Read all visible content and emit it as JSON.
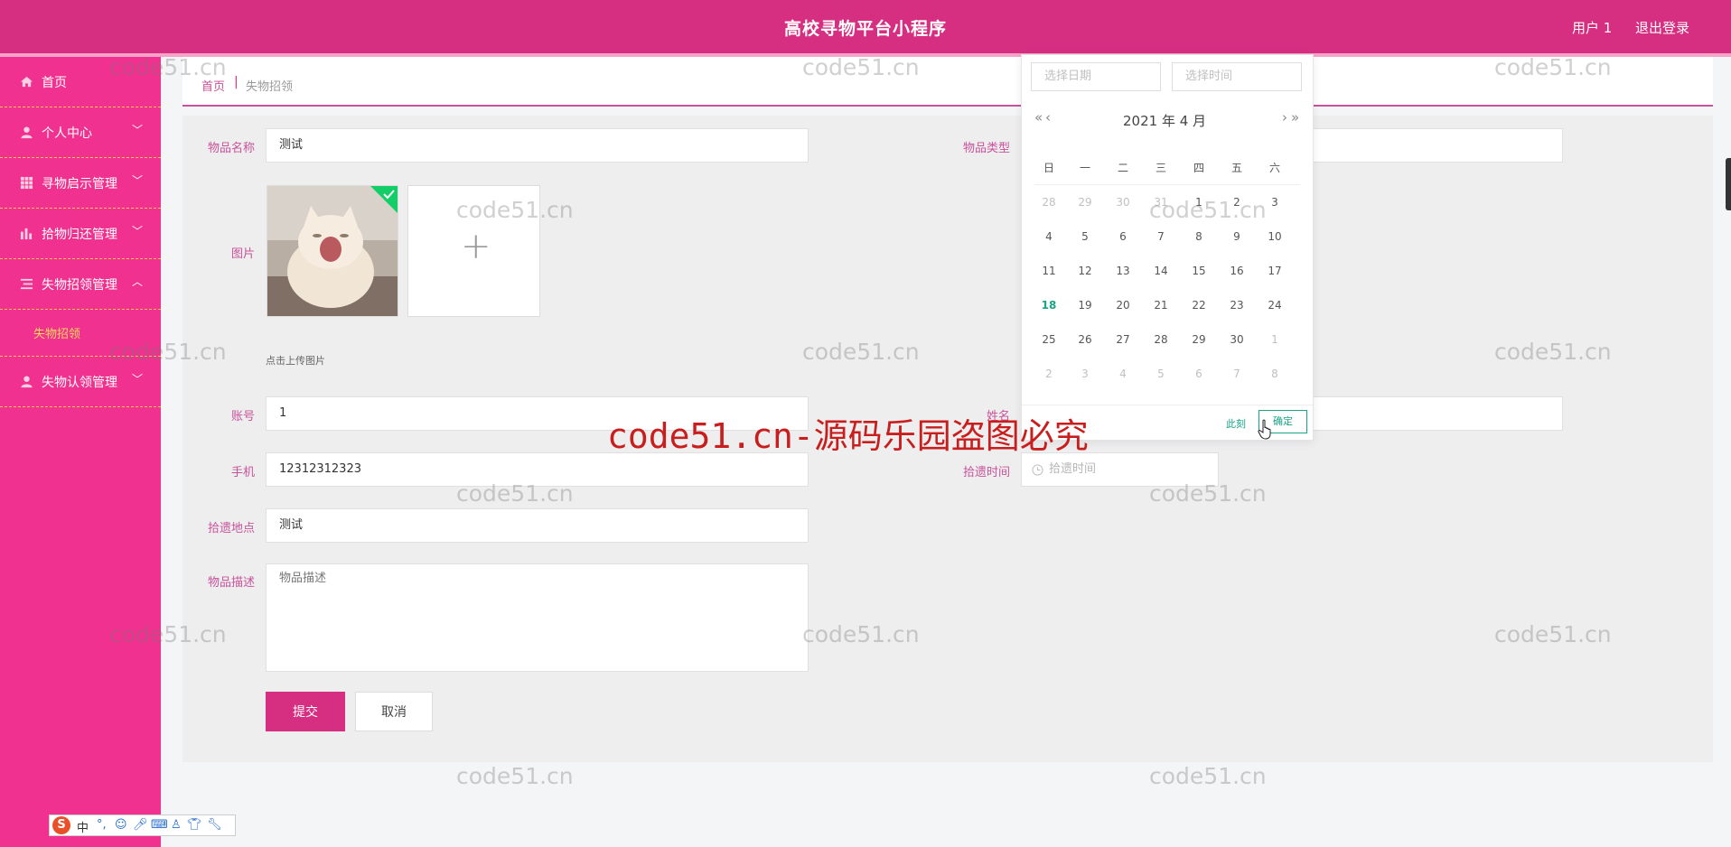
{
  "header": {
    "title": "高校寻物平台小程序",
    "user": "用户 1",
    "logout": "退出登录"
  },
  "sidebar": {
    "items": [
      {
        "label": "首页",
        "icon": "home-icon"
      },
      {
        "label": "个人中心",
        "icon": "user-icon"
      },
      {
        "label": "寻物启示管理",
        "icon": "grid-icon"
      },
      {
        "label": "拾物归还管理",
        "icon": "bar-chart-icon"
      },
      {
        "label": "失物招领管理",
        "icon": "list-icon"
      },
      {
        "label": "失物认领管理",
        "icon": "user-icon"
      }
    ],
    "sub_item": "失物招领"
  },
  "breadcrumb": {
    "home": "首页",
    "separator": "|",
    "current": "失物招领"
  },
  "form": {
    "name_label": "物品名称",
    "name_value": "测试",
    "type_label": "物品类型",
    "image_label": "图片",
    "upload_hint": "点击上传图片",
    "account_label": "账号",
    "account_value": "1",
    "owner_label": "姓名",
    "phone_label": "手机",
    "phone_value": "12312312323",
    "time_label": "拾遗时间",
    "time_placeholder": "拾遗时间",
    "place_label": "拾遗地点",
    "place_value": "测试",
    "desc_label": "物品描述",
    "desc_placeholder": "物品描述",
    "submit": "提交",
    "cancel": "取消"
  },
  "datepicker": {
    "date_placeholder": "选择日期",
    "time_placeholder": "选择时间",
    "month_label": "2021 年  4 月",
    "prev_year": "«",
    "prev_month": "‹",
    "next_month": "›",
    "next_year": "»",
    "weekdays": [
      "日",
      "一",
      "二",
      "三",
      "四",
      "五",
      "六"
    ],
    "weeks": [
      [
        "28",
        "29",
        "30",
        "31",
        "1",
        "2",
        "3"
      ],
      [
        "4",
        "5",
        "6",
        "7",
        "8",
        "9",
        "10"
      ],
      [
        "11",
        "12",
        "13",
        "14",
        "15",
        "16",
        "17"
      ],
      [
        "18",
        "19",
        "20",
        "21",
        "22",
        "23",
        "24"
      ],
      [
        "25",
        "26",
        "27",
        "28",
        "29",
        "30",
        "1"
      ],
      [
        "2",
        "3",
        "4",
        "5",
        "6",
        "7",
        "8"
      ]
    ],
    "today": "18",
    "now": "此刻",
    "confirm": "确定"
  },
  "watermark": "code51.cn",
  "banner": "code51.cn-源码乐园盗图必究",
  "ime": {
    "logo": "S",
    "mode": "中"
  },
  "colors": {
    "primary": "#d62f82",
    "sidebar": "#f0318f",
    "accent": "#1aa385",
    "submenu_text": "#f6d85a"
  }
}
